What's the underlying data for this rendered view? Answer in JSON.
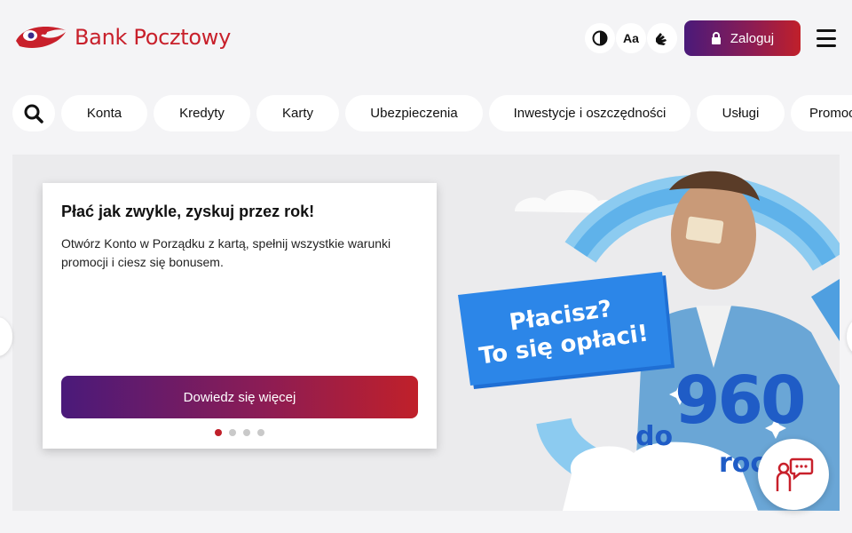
{
  "brand": {
    "name": "Bank Pocztowy"
  },
  "header": {
    "contrast_icon": "contrast-icon",
    "font_size_label": "Aa",
    "sign_language_icon": "sign-language-icon",
    "login_label": "Zaloguj",
    "menu_icon": "hamburger-menu-icon"
  },
  "nav": {
    "search_icon": "search-icon",
    "items": [
      {
        "label": "Konta"
      },
      {
        "label": "Kredyty"
      },
      {
        "label": "Karty"
      },
      {
        "label": "Ubezpieczenia"
      },
      {
        "label": "Inwestycje i oszczędności"
      },
      {
        "label": "Usługi"
      },
      {
        "label": "Promocje"
      }
    ]
  },
  "hero": {
    "title": "Płać jak zwykle, zyskuj przez rok!",
    "description": "Otwórz Konto w Porządku z kartą, spełnij wszystkie warunki promocji i ciesz się bonusem.",
    "cta_label": "Dowiedz się więcej",
    "slides_total": 4,
    "slide_active": 1,
    "promo_line1": "Płacisz?",
    "promo_line2": "To się opłaci!",
    "promo_prefix": "do",
    "promo_amount": "960",
    "promo_suffix": "rocznie"
  },
  "chat": {
    "icon": "chat-support-icon"
  },
  "colors": {
    "brand_red": "#c8202b",
    "gradient_start": "#4a1a7a",
    "gradient_end": "#c0202a",
    "promo_blue": "#1f5cc6"
  }
}
